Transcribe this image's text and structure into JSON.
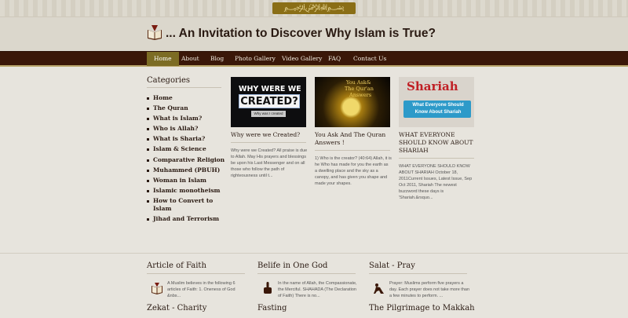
{
  "site": {
    "title": "... An Invitation to Discover Why Islam is True?"
  },
  "nav": {
    "items": [
      {
        "label": "Home",
        "active": true
      },
      {
        "label": "About",
        "active": false
      },
      {
        "label": "Blog",
        "active": false
      },
      {
        "label": "Photo Gallery",
        "active": false
      },
      {
        "label": "Video Gallery",
        "active": false
      },
      {
        "label": "FAQ",
        "active": false
      },
      {
        "label": "Contact Us",
        "active": false
      }
    ]
  },
  "sidebar": {
    "title": "Categories",
    "items": [
      "Home",
      "The Quran",
      "What is Islam?",
      "Who is Allah?",
      "What is Sharia?",
      "Islam & Science",
      "Comparative Religion",
      "Muhammed (PBUH)",
      "Woman in Islam",
      "Islamic monotheism",
      "How to Convert to Islam",
      "Jihad and Terrorism"
    ]
  },
  "posts": [
    {
      "image_text_1": "WHY WERE WE",
      "image_text_2": "CREATED?",
      "image_text_3": "Why was I created",
      "title": "Why were we Created?",
      "excerpt": "Why were we Created? All praise is due to Allah. May His prayers and blessings be upon his Last Messenger and on all those who follow the path of righteousness until t..."
    },
    {
      "image_text_1": "You Ask&",
      "image_text_2": "The Qur'an",
      "image_text_3": "Answers",
      "title": "You Ask And The Quran Answers !",
      "excerpt": "1) Who is the creator? (40:64) Allah, it is he Who has made for you the earth as a dwelling place and the sky as a canopy, and has given you shape and made your shapes."
    },
    {
      "image_text_1": "Shariah",
      "image_text_2": "What Everyone Should",
      "image_text_3": "Know About Shariah",
      "title": "WHAT EVERYONE SHOULD KNOW ABOUT SHARIAH",
      "excerpt": "WHAT EVERYONE SHOULD KNOW ABOUT SHARIAH October 18, 2011Current Issues, Latest Issue, Sep Oct 2011, Shariah The newest buzzword these days is 'Shariah.&rsquo..."
    }
  ],
  "features": [
    {
      "title": "Article of Faith",
      "text": "A Muslim believes in the following 6 articles of Faith: 1. Oneness of God &nbs..."
    },
    {
      "title": "Belife in One God",
      "text": "In the name of Allah, the Compassionate, the Merciful. SHAHADA (The Declaration of Faith) There is no..."
    },
    {
      "title": "Salat - Pray",
      "text": "Prayer: Muslims perform five prayers a day. Each prayer does not take more than a few minutes to perform. ..."
    },
    {
      "title": "Zekat - Charity",
      "text": ""
    },
    {
      "title": "Fasting",
      "text": ""
    },
    {
      "title": "The Pilgrimage to Makkah",
      "text": ""
    }
  ],
  "colors": {
    "nav_bg": "#3a1708",
    "nav_active": "#7c6c24",
    "page_bg": "#e7e4dd",
    "heading": "#2a1a12"
  }
}
